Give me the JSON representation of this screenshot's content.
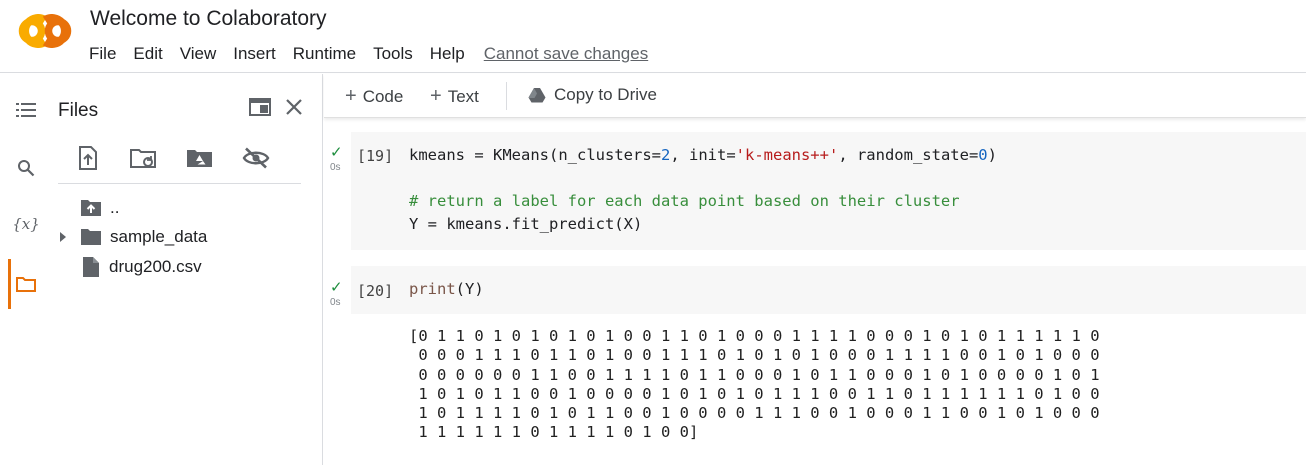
{
  "header": {
    "logo_text": "CO",
    "title": "Welcome to Colaboratory",
    "menu": [
      "File",
      "Edit",
      "View",
      "Insert",
      "Runtime",
      "Tools",
      "Help"
    ],
    "save_status": "Cannot save changes"
  },
  "rail": {
    "items": [
      "toc-icon",
      "search-icon",
      "variables-icon",
      "files-icon"
    ],
    "variables_glyph": "{x}"
  },
  "files": {
    "title": "Files",
    "tree": [
      {
        "label": "..",
        "type": "parent"
      },
      {
        "label": "sample_data",
        "type": "folder"
      },
      {
        "label": "drug200.csv",
        "type": "file"
      }
    ]
  },
  "toolbar": {
    "code_label": "Code",
    "text_label": "Text",
    "drive_label": "Copy to Drive"
  },
  "cells": [
    {
      "prompt": "[19]",
      "time": "0s",
      "line1_var": "kmeans = ",
      "line1_fn": "KMeans",
      "line1_a": "(n_clusters=",
      "line1_n1": "2",
      "line1_b": ", init=",
      "line1_str": "'k-means++'",
      "line1_c": ", random_state=",
      "line1_n2": "0",
      "line1_d": ")",
      "comment": "# return a label for each data point based on their cluster",
      "line3": "Y = kmeans.fit_predict(X)"
    },
    {
      "prompt": "[20]",
      "time": "0s",
      "code_fn": "print",
      "code_rest": "(Y)",
      "output": "[0 1 1 0 1 0 1 0 1 0 1 0 0 1 1 0 1 0 0 0 1 1 1 1 0 0 0 1 0 1 0 1 1 1 1 1 0\n 0 0 0 1 1 1 0 1 1 0 1 0 0 1 1 1 0 1 0 1 0 1 0 0 0 1 1 1 1 0 0 1 0 1 0 0 0\n 0 0 0 0 0 0 1 1 0 0 1 1 1 1 0 1 1 0 0 0 1 0 1 1 0 0 0 1 0 1 0 0 0 0 1 0 1\n 1 0 1 0 1 1 0 0 1 0 0 0 0 1 0 1 0 1 0 1 1 1 0 0 1 1 0 1 1 1 1 1 1 0 1 0 0\n 1 0 1 1 1 1 0 1 0 1 1 0 0 1 0 0 0 0 1 1 1 0 0 1 0 0 0 1 1 0 0 1 0 1 0 0 0\n 1 1 1 1 1 1 0 1 1 1 1 0 1 0 0]"
    }
  ],
  "colors": {
    "logo_orange": "#F9AB00",
    "logo_deep_orange": "#E8710A",
    "check_green": "#1e8e3e"
  }
}
